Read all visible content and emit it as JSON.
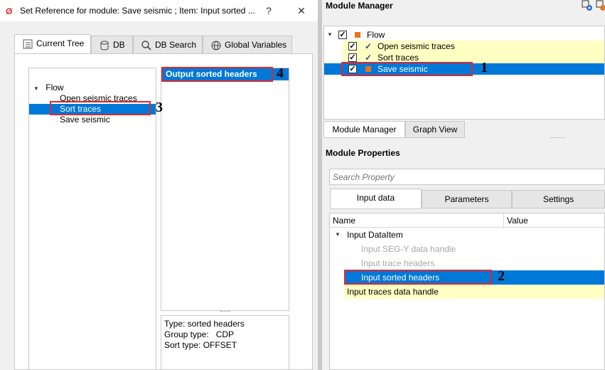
{
  "dialog": {
    "title": "Set Reference for module: Save seismic ; Item: Input sorted ...",
    "help": "?",
    "close": "✕",
    "tabs": [
      "Current Tree",
      "DB",
      "DB Search",
      "Global Variables"
    ],
    "tree": {
      "root": "Flow",
      "items": [
        "Open seismic traces",
        "Sort traces",
        "Save seismic"
      ],
      "selected": "Sort traces"
    },
    "items_list": [
      "Output sorted headers"
    ],
    "info": [
      "Type: sorted headers",
      "Group type:   CDP",
      "Sort type: OFFSET"
    ]
  },
  "module_manager": {
    "title": "Module Manager",
    "tree": {
      "root": "Flow",
      "items": [
        "Open seismic traces",
        "Sort traces",
        "Save seismic"
      ]
    },
    "tabs": [
      "Module Manager",
      "Graph View"
    ]
  },
  "module_properties": {
    "title": "Module Properties",
    "search_placeholder": "Search Property",
    "tabs": [
      "Input data",
      "Parameters",
      "Settings"
    ],
    "columns": [
      "Name",
      "Value"
    ],
    "group": "Input DataItem",
    "rows": [
      "Input SEG-Y data handle",
      "Input trace headers",
      "Input sorted headers",
      "Input traces data handle"
    ]
  },
  "annotations": [
    "1",
    "2",
    "3",
    "4"
  ],
  "colors": {
    "selection": "#0078d7",
    "highlight": "#ffffc4",
    "annotation_box": "#e0262e",
    "module_square": "#e8731c"
  }
}
